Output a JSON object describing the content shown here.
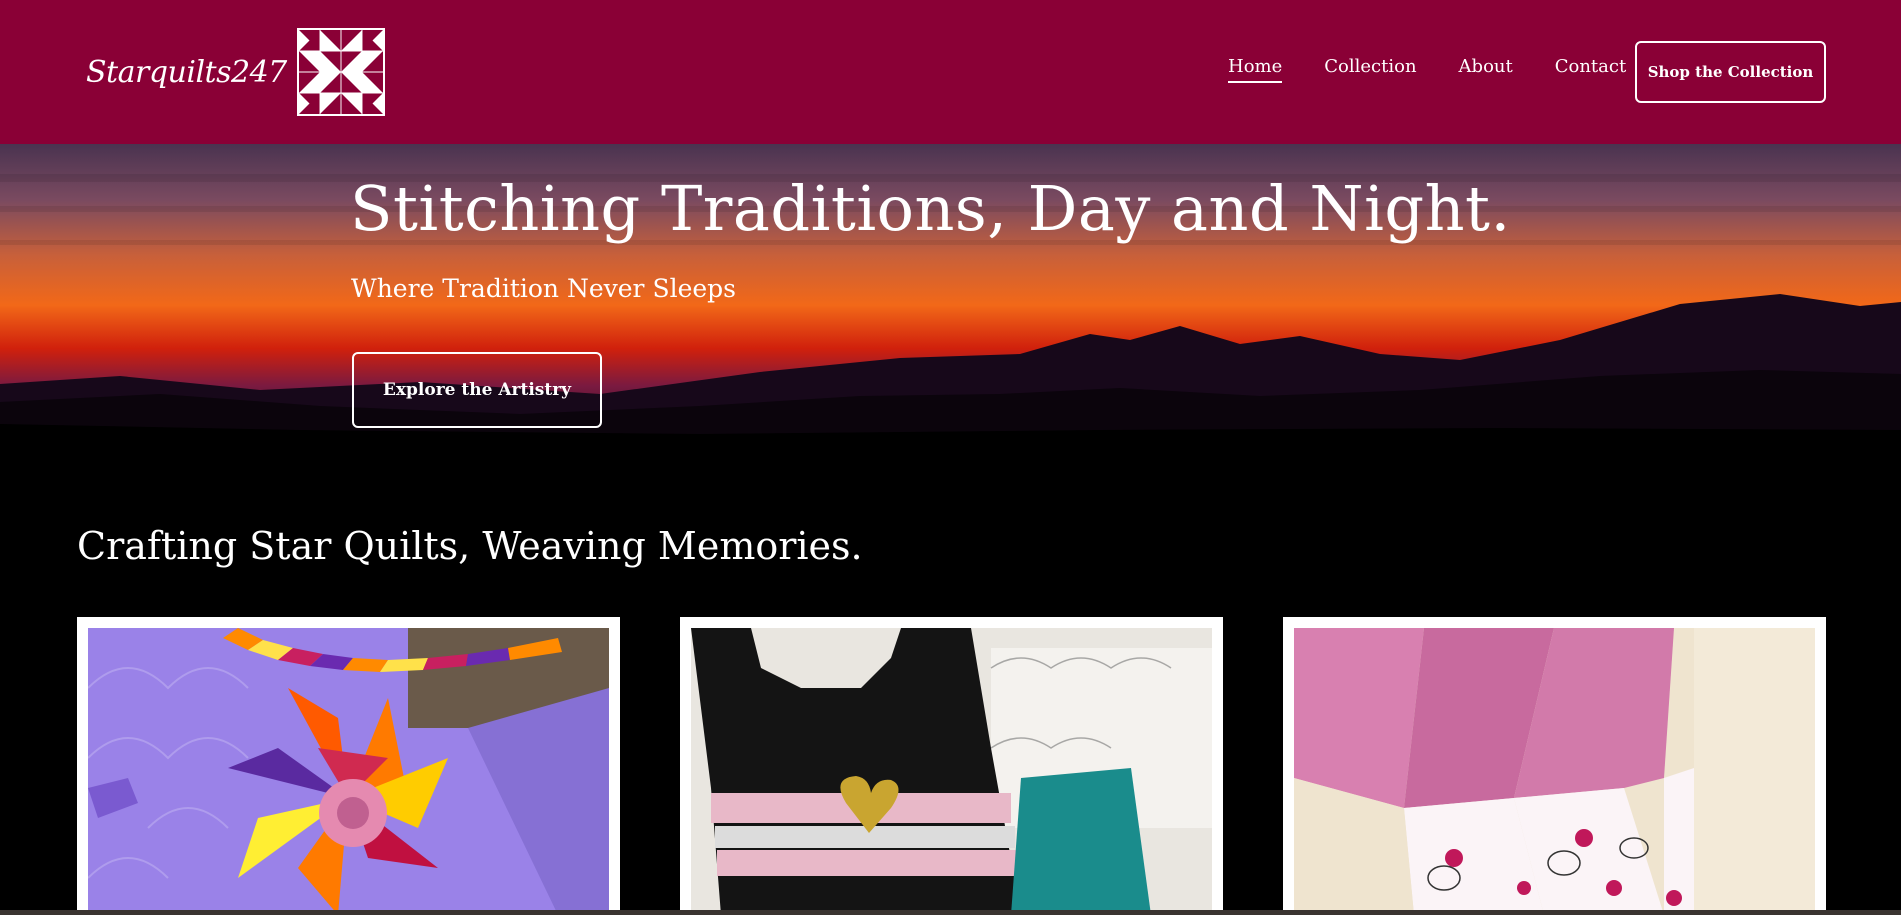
{
  "header": {
    "logo_text": "Starquilts247",
    "nav": [
      {
        "label": "Home",
        "active": true
      },
      {
        "label": "Collection",
        "active": false
      },
      {
        "label": "About",
        "active": false
      },
      {
        "label": "Contact",
        "active": false
      }
    ],
    "cta_label": "Shop the Collection"
  },
  "hero": {
    "title": "Stitching Traditions, Day and Night.",
    "subtitle": "Where Tradition Never Sleeps",
    "button_label": "Explore the Artistry"
  },
  "section": {
    "title": "Crafting Star Quilts, Weaving Memories."
  },
  "colors": {
    "brand": "#8a0036",
    "background": "#000000",
    "text": "#ffffff"
  }
}
